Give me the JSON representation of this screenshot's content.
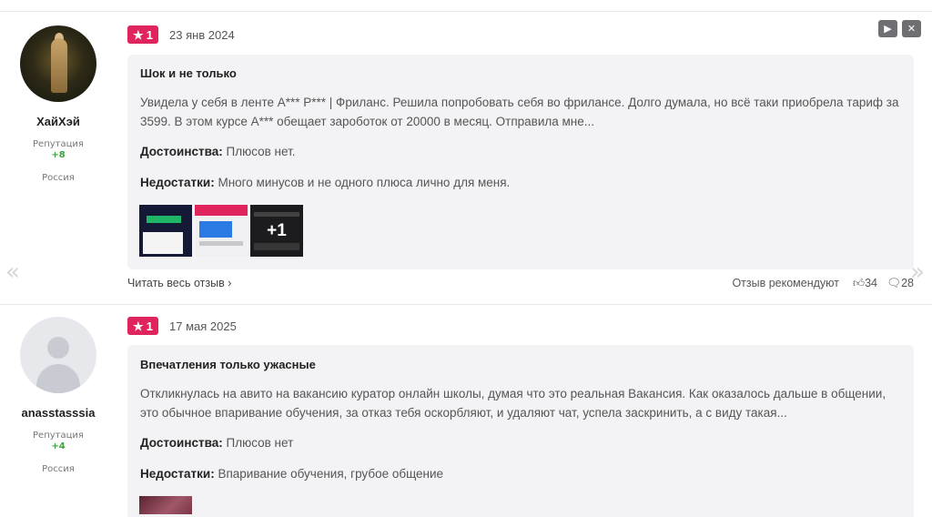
{
  "reviews": [
    {
      "author": {
        "name": "ХайХэй",
        "reputation_label": "Репутация",
        "reputation": "+8",
        "country": "Россия"
      },
      "rating": "1",
      "date": "23 янв 2024",
      "title": "Шок и не только",
      "text": "Увидела у себя в ленте А*** Р*** | Фриланс. Решила попробовать себя во фрилансе. Долго думала, но всё таки приобрела тариф за 3599. В этом курсе А*** обещает зароботок от 20000 в месяц. Отправила мне...",
      "pros_label": "Достоинства:",
      "pros": "Плюсов нет.",
      "cons_label": "Недостатки:",
      "cons": "Много минусов и не одного плюса лично для меня.",
      "more_photos": "+1",
      "read_more": "Читать весь отзыв",
      "recommend_label": "Отзыв рекомендуют",
      "likes": "34",
      "comments": "28"
    },
    {
      "author": {
        "name": "anasstasssia",
        "reputation_label": "Репутация",
        "reputation": "+4",
        "country": "Россия"
      },
      "rating": "1",
      "date": "17 мая 2025",
      "title": "Впечатления только ужасные",
      "text": "Откликнулась на авито на вакансию куратор онлайн школы, думая что это реальная Вакансия. Как оказалось дальше в общении, это обычное впаривание обучения, за отказ тебя оскорбляют, и удаляют чат, успела заскринить, а с виду такая...",
      "pros_label": "Достоинства:",
      "pros": "Плюсов нет",
      "cons_label": "Недостатки:",
      "cons": "Впаривание обучения, грубое общение"
    }
  ],
  "colors": {
    "rating_badge": "#e0245e",
    "reputation": "#3aa33a",
    "card_bg": "#f3f3f5"
  },
  "icons": {
    "star": "star-icon",
    "play": "play-icon",
    "close": "close-icon",
    "like": "thumbs-up-icon",
    "comment": "comment-icon"
  }
}
